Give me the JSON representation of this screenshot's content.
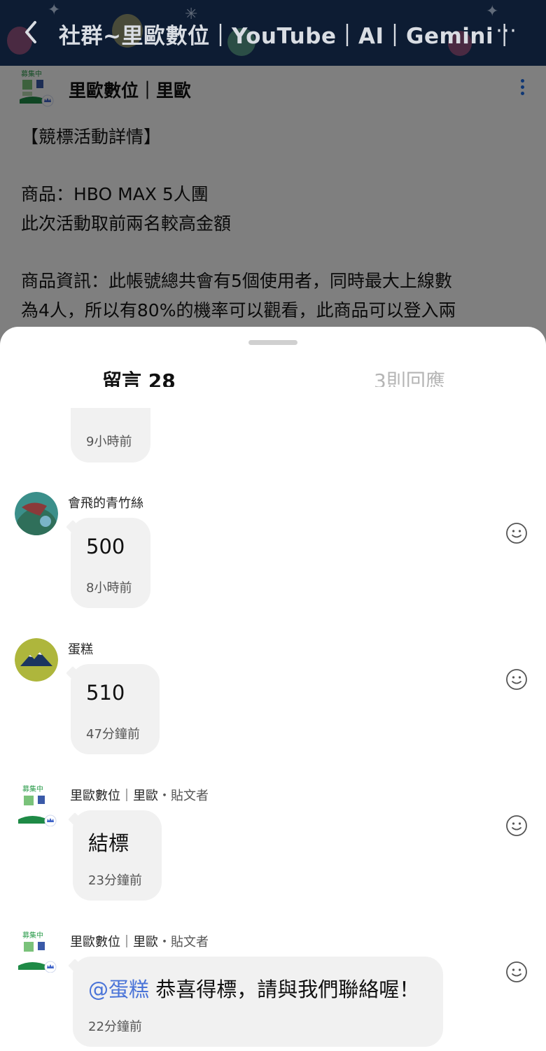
{
  "header": {
    "title": "社群~里歐數位｜YouTube｜AI｜Gemini｜",
    "more_label": "⋯"
  },
  "post": {
    "author": "里歐數位｜里歐",
    "lines": [
      "【競標活動詳情】",
      "商品：HBO MAX 5人團",
      "此次活動取前兩名較高金額",
      "商品資訊：此帳號總共會有5個使用者，同時最大上線數",
      "為4人，所以有80%的機率可以觀看，此商品可以登入兩"
    ]
  },
  "tabs": {
    "comments": "留言 28",
    "reactions": "3則回應"
  },
  "comments": [
    {
      "time": "9小時前"
    },
    {
      "name": "會飛的青竹絲",
      "text": "500",
      "time": "8小時前"
    },
    {
      "name": "蛋糕",
      "text": "510",
      "time": "47分鐘前"
    },
    {
      "name": "里歐數位｜里歐",
      "role": "・貼文者",
      "text": "結標",
      "time": "23分鐘前"
    },
    {
      "name": "里歐數位｜里歐",
      "role": "・貼文者",
      "mention": "@蛋糕",
      "text": "恭喜得標，請與我們聯絡喔！",
      "time": "22分鐘前"
    }
  ],
  "avatar_badge_text": "募集中",
  "colors": {
    "header_bg": "#0d1c33",
    "mention": "#4a74d8",
    "bubble_bg": "#f1f1f1",
    "accent_blue": "#1f6fe8"
  }
}
